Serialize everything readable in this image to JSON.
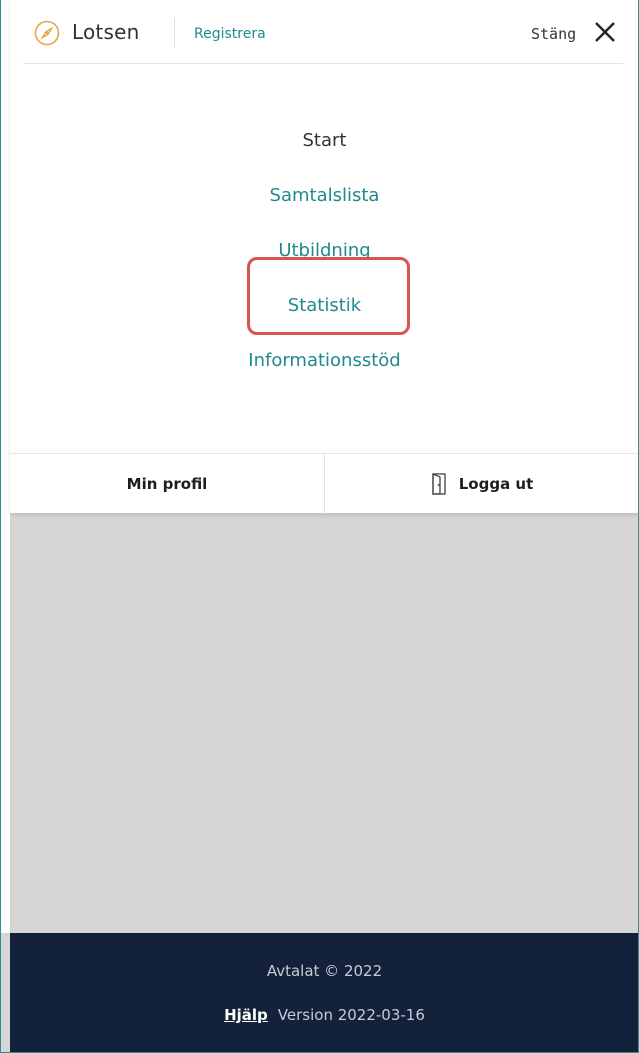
{
  "header": {
    "brand": "Lotsen",
    "register_link": "Registrera",
    "close_label": "Stäng",
    "logo_icon": "compass-icon",
    "close_icon": "close-x-icon"
  },
  "menu": {
    "items": [
      {
        "label": "Start",
        "state": "current"
      },
      {
        "label": "Samtalslista",
        "state": "link"
      },
      {
        "label": "Utbildning",
        "state": "link"
      },
      {
        "label": "Statistik",
        "state": "link",
        "highlighted": true
      },
      {
        "label": "Informationsstöd",
        "state": "link"
      }
    ]
  },
  "bottom_bar": {
    "profile_label": "Min profil",
    "logout_label": "Logga ut",
    "logout_icon": "door-icon"
  },
  "footer": {
    "copyright": "Avtalat © 2022",
    "help_link": "Hjälp",
    "version": "Version 2022-03-16"
  },
  "colors": {
    "accent": "#1f8a8c",
    "highlight_border": "#d9534f",
    "footer_bg": "#13213a",
    "overlay_bg": "#d6d6d6"
  }
}
